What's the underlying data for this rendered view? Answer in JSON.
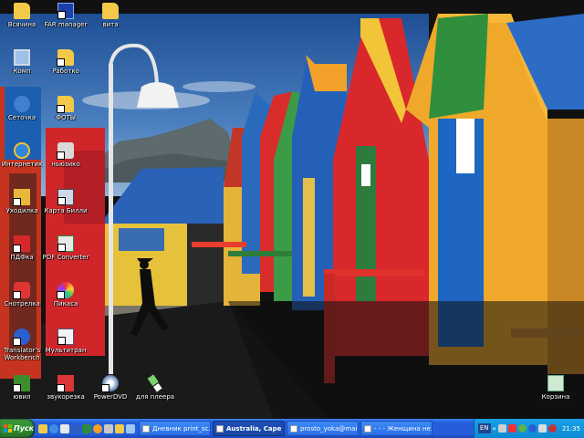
{
  "desktop": {
    "icons": [
      {
        "label": "Всячина",
        "icon": "folder-icon"
      },
      {
        "label": "FAR manager",
        "icon": "far-manager-icon"
      },
      {
        "label": "витa",
        "icon": "folder-icon"
      },
      {
        "label": "Комп",
        "icon": "my-computer-icon"
      },
      {
        "label": "Работко",
        "icon": "folder-icon"
      },
      {
        "label": "Сеточка",
        "icon": "network-icon"
      },
      {
        "label": "ФОТЫ",
        "icon": "folder-icon"
      },
      {
        "label": "Интернетик",
        "icon": "internet-explorer-icon"
      },
      {
        "label": "ньюзико",
        "icon": "news-icon"
      },
      {
        "label": "Уходилка",
        "icon": "exit-icon"
      },
      {
        "label": "Карта Билли",
        "icon": "map-icon"
      },
      {
        "label": "ПДФка",
        "icon": "pdf-icon"
      },
      {
        "label": "PDF Converter",
        "icon": "pdf-converter-icon"
      },
      {
        "label": "Снотрелка",
        "icon": "viewer-icon"
      },
      {
        "label": "Пикаса",
        "icon": "picasa-icon"
      },
      {
        "label": "Translator's Workbench",
        "icon": "translator-icon"
      },
      {
        "label": "Мультитран",
        "icon": "multitran-icon"
      },
      {
        "label": "ювил",
        "icon": "yuvil-icon"
      },
      {
        "label": "звукорезка",
        "icon": "sound-cutter-icon"
      },
      {
        "label": "PowerDVD",
        "icon": "powerdvd-icon"
      },
      {
        "label": "для плеера",
        "icon": "player-icon"
      },
      {
        "label": "Корзина",
        "icon": "recycle-bin-icon"
      }
    ]
  },
  "taskbar": {
    "start_label": "Пуск",
    "quick_launch": [
      "explorer-icon",
      "browser-icon",
      "mail-icon",
      "word-icon",
      "excel-icon",
      "media-icon",
      "calc-icon",
      "folder-icon",
      "notepad-icon"
    ],
    "tasks": [
      {
        "label": "Дневник print_sc...",
        "active": false
      },
      {
        "label": "Australia, Cape ...",
        "active": true
      },
      {
        "label": "prosto_yoka@mai...",
        "active": false
      },
      {
        "label": "- - - Женщина не...",
        "active": false
      }
    ],
    "tray": {
      "language": "EN",
      "clock": "21:35",
      "arrow": "«"
    }
  },
  "colors": {
    "taskbar_blue": "#245edb",
    "start_green": "#2f8a2f",
    "tray_blue": "#0f8ad4"
  }
}
